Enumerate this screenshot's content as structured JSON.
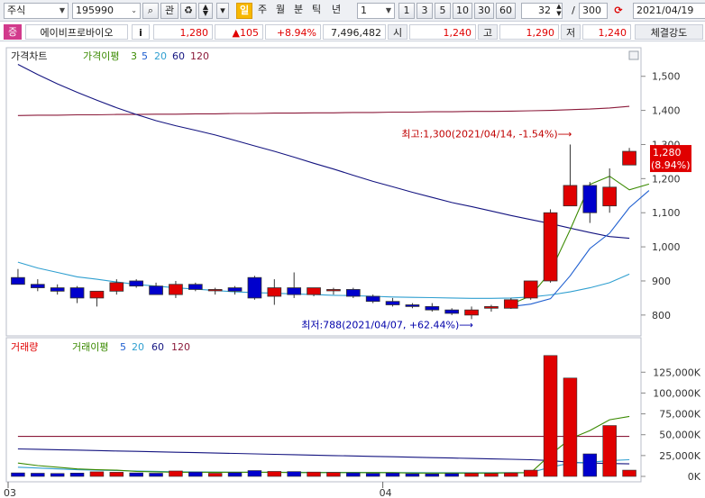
{
  "toolbar": {
    "market": "주식",
    "code": "195990",
    "btn_search": "⌕",
    "btn_watch": "관",
    "btn_period_active": "일",
    "periods": [
      "주",
      "월",
      "분",
      "틱",
      "년"
    ],
    "interval_value": "1",
    "quick_intervals": [
      "1",
      "3",
      "5",
      "10",
      "30",
      "60"
    ],
    "count_value": "32",
    "count_sep": "/",
    "count_total": "300",
    "date": "2021/04/19"
  },
  "quote": {
    "badge": "증",
    "name": "에이비프로바이오",
    "info_btn": "i",
    "price": "1,280",
    "change": "▲105",
    "change_pct": "+8.94%",
    "volume": "7,496,482",
    "open_label": "시",
    "open": "1,240",
    "high_label": "고",
    "high": "1,290",
    "low_label": "저",
    "low": "1,240",
    "strength_label": "체결강도"
  },
  "colors": {
    "up": "#e00000",
    "down": "#0000cc",
    "ma3": "#3a8a00",
    "ma5": "#1f5fd0",
    "ma20": "#2f9fd0",
    "ma60": "#141480",
    "ma120": "#8b1a3a"
  },
  "chart_data": [
    {
      "type": "candlestick",
      "title": "가격차트",
      "legend": [
        "가격이평",
        "3",
        "5",
        "20",
        "60",
        "120"
      ],
      "x_labels": [
        "03",
        "04"
      ],
      "y_ticks": [
        800,
        900,
        1000,
        1100,
        1200,
        1300,
        1400,
        1500
      ],
      "ylim": [
        760,
        1560
      ],
      "current_price_label": "1,280",
      "current_pct_label": "(8.94%)",
      "high_annotation": "최고:1,300(2021/04/14, -1.54%)⟶",
      "low_annotation": "최저:788(2021/04/07, +62.44%)⟶",
      "candles": [
        {
          "o": 910,
          "h": 935,
          "l": 890,
          "c": 890
        },
        {
          "o": 890,
          "h": 905,
          "l": 870,
          "c": 880
        },
        {
          "o": 880,
          "h": 890,
          "l": 860,
          "c": 870
        },
        {
          "o": 880,
          "h": 885,
          "l": 835,
          "c": 850
        },
        {
          "o": 850,
          "h": 870,
          "l": 825,
          "c": 870
        },
        {
          "o": 870,
          "h": 905,
          "l": 860,
          "c": 895
        },
        {
          "o": 900,
          "h": 905,
          "l": 880,
          "c": 885
        },
        {
          "o": 885,
          "h": 895,
          "l": 860,
          "c": 860
        },
        {
          "o": 860,
          "h": 900,
          "l": 850,
          "c": 890
        },
        {
          "o": 890,
          "h": 895,
          "l": 870,
          "c": 875
        },
        {
          "o": 875,
          "h": 880,
          "l": 860,
          "c": 875
        },
        {
          "o": 880,
          "h": 885,
          "l": 860,
          "c": 870
        },
        {
          "o": 910,
          "h": 915,
          "l": 845,
          "c": 850
        },
        {
          "o": 855,
          "h": 905,
          "l": 830,
          "c": 880
        },
        {
          "o": 880,
          "h": 925,
          "l": 850,
          "c": 860
        },
        {
          "o": 860,
          "h": 880,
          "l": 855,
          "c": 880
        },
        {
          "o": 875,
          "h": 880,
          "l": 860,
          "c": 875
        },
        {
          "o": 875,
          "h": 880,
          "l": 850,
          "c": 855
        },
        {
          "o": 855,
          "h": 860,
          "l": 835,
          "c": 840
        },
        {
          "o": 840,
          "h": 850,
          "l": 825,
          "c": 830
        },
        {
          "o": 830,
          "h": 835,
          "l": 820,
          "c": 825
        },
        {
          "o": 825,
          "h": 835,
          "l": 810,
          "c": 815
        },
        {
          "o": 815,
          "h": 820,
          "l": 800,
          "c": 805
        },
        {
          "o": 800,
          "h": 825,
          "l": 788,
          "c": 815
        },
        {
          "o": 820,
          "h": 830,
          "l": 810,
          "c": 825
        },
        {
          "o": 820,
          "h": 850,
          "l": 818,
          "c": 845
        },
        {
          "o": 850,
          "h": 900,
          "l": 845,
          "c": 900
        },
        {
          "o": 900,
          "h": 1110,
          "l": 895,
          "c": 1100
        },
        {
          "o": 1120,
          "h": 1300,
          "l": 1120,
          "c": 1180
        },
        {
          "o": 1180,
          "h": 1190,
          "l": 1070,
          "c": 1100
        },
        {
          "o": 1120,
          "h": 1230,
          "l": 1100,
          "c": 1175
        },
        {
          "o": 1240,
          "h": 1290,
          "l": 1240,
          "c": 1280
        }
      ],
      "ma": {
        "ma3": {
          "from": 25,
          "values": [
            832,
            856,
            927,
            1050,
            1183,
            1207,
            1167,
            1184
          ]
        },
        "ma5": {
          "from": 25,
          "values": [
            825,
            832,
            848,
            915,
            995,
            1040,
            1115,
            1165
          ]
        },
        "ma20": [
          955,
          938,
          925,
          912,
          905,
          897,
          890,
          885,
          880,
          876,
          872,
          868,
          866,
          864,
          862,
          860,
          858,
          857,
          855,
          853,
          852,
          851,
          850,
          849,
          849,
          850,
          853,
          859,
          868,
          880,
          895,
          920
        ],
        "ma60": [
          1535,
          1505,
          1478,
          1453,
          1430,
          1408,
          1388,
          1370,
          1355,
          1342,
          1328,
          1312,
          1296,
          1280,
          1263,
          1245,
          1228,
          1210,
          1192,
          1176,
          1160,
          1145,
          1130,
          1118,
          1105,
          1092,
          1080,
          1068,
          1055,
          1042,
          1030,
          1025
        ],
        "ma120": [
          1385,
          1386,
          1386,
          1387,
          1387,
          1388,
          1388,
          1389,
          1389,
          1390,
          1390,
          1391,
          1391,
          1392,
          1392,
          1393,
          1393,
          1394,
          1394,
          1395,
          1395,
          1396,
          1396,
          1397,
          1397,
          1398,
          1399,
          1400,
          1402,
          1404,
          1407,
          1412
        ]
      }
    },
    {
      "type": "bar",
      "title": "거래량",
      "legend": [
        "거래이평",
        "5",
        "20",
        "60",
        "120"
      ],
      "y_ticks": [
        "0K",
        "25,000K",
        "50,000K",
        "75,000K",
        "100,000K",
        "125,000K"
      ],
      "y_tick_values": [
        0,
        25000,
        50000,
        75000,
        100000,
        125000
      ],
      "ylim": [
        0,
        148000
      ],
      "values": [
        4200,
        3800,
        3500,
        4000,
        5500,
        5000,
        4200,
        3800,
        6500,
        5200,
        3800,
        4500,
        7000,
        6000,
        5800,
        5200,
        4800,
        4200,
        3600,
        4000,
        3200,
        3000,
        3400,
        3800,
        3600,
        4200,
        7500,
        145000,
        118000,
        27000,
        61000,
        7500
      ],
      "ma": {
        "ma5": [
          16000,
          13000,
          11000,
          9000,
          8000,
          7500,
          6000,
          5500,
          5000,
          5000,
          5000,
          5000,
          5000,
          5000,
          4500,
          4500,
          4500,
          4500,
          4500,
          4500,
          4000,
          4000,
          4000,
          4000,
          4000,
          4200,
          4400,
          26000,
          45000,
          55000,
          68000,
          72000
        ],
        "ma20": [
          11000,
          10000,
          9000,
          8000,
          7500,
          7000,
          6500,
          6000,
          5500,
          5300,
          5200,
          5100,
          5000,
          5000,
          5000,
          4900,
          4800,
          4700,
          4600,
          4500,
          4500,
          4400,
          4400,
          4400,
          4400,
          4500,
          4600,
          11000,
          16000,
          17000,
          19000,
          20000
        ],
        "ma60": [
          33000,
          32500,
          32000,
          31500,
          31000,
          30500,
          30000,
          29500,
          29000,
          28500,
          28000,
          27500,
          27000,
          26500,
          26000,
          25500,
          25000,
          24500,
          24000,
          23500,
          23000,
          22500,
          22000,
          21500,
          21000,
          20500,
          20000,
          19000,
          17000,
          16000,
          15500,
          15000
        ],
        "ma120": [
          48000,
          48000,
          48000,
          48000,
          48000,
          48000,
          48000,
          48000,
          48000,
          48000,
          48000,
          48000,
          48000,
          48000,
          48000,
          48000,
          48000,
          48000,
          48000,
          48000,
          48000,
          48000,
          48000,
          48000,
          48000,
          48000,
          48000,
          48000,
          48000,
          48000,
          48000,
          48000
        ]
      }
    }
  ]
}
